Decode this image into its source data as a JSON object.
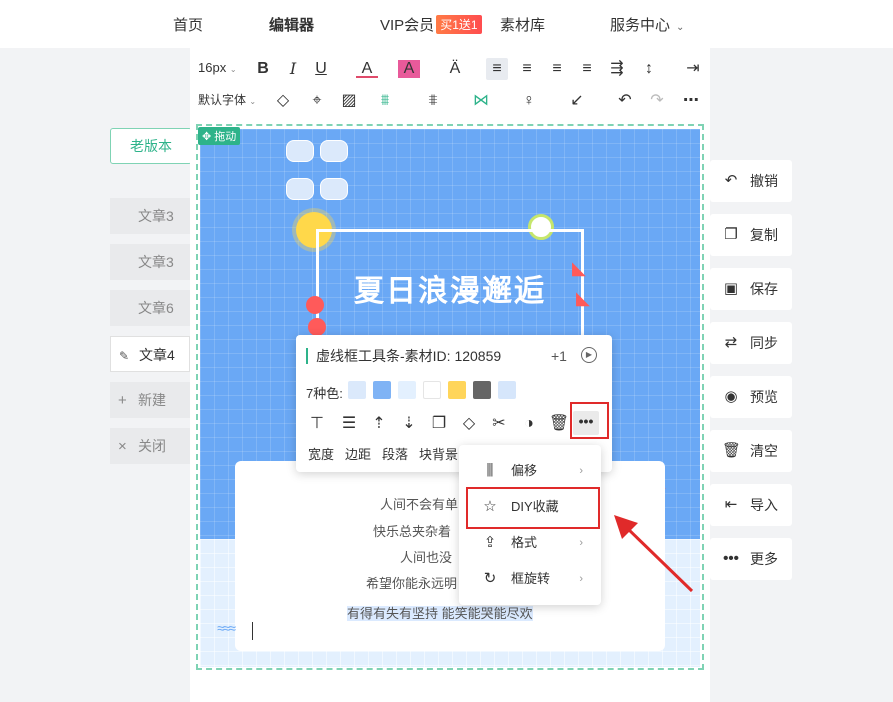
{
  "nav": {
    "items": [
      {
        "label": "首页"
      },
      {
        "label": "编辑器"
      },
      {
        "label": "VIP会员"
      },
      {
        "label": "素材库"
      },
      {
        "label": "服务中心"
      }
    ],
    "vip_badge": "买1送1"
  },
  "toolbar": {
    "font_size": "16px",
    "font_family": "默认字体"
  },
  "left": {
    "old_version": "老版本",
    "docs": [
      {
        "label": "文章3"
      },
      {
        "label": "文章3"
      },
      {
        "label": "文章6"
      },
      {
        "label": "文章4"
      }
    ],
    "new_label": "新建",
    "close_label": "关闭"
  },
  "canvas": {
    "drag_label": "拖动",
    "poster_title": "夏日浪漫邂逅",
    "poem": [
      "人间不会有单",
      "快乐总夹杂着",
      "人间也没",
      "希望你能永远明",
      "有得有失有坚持 能笑能哭能尽欢"
    ],
    "waves": "≈≈≈"
  },
  "popup": {
    "title": "虚线框工具条-素材ID: 120859",
    "plus": "+1",
    "colors_label": "7种色:",
    "colors": [
      "#dbe9fb",
      "#7fb3f5",
      "#e3f0fe",
      "#ffffff",
      "#ffd55a",
      "#666666",
      "#d6e6fb"
    ],
    "tabs": [
      "宽度",
      "边距",
      "段落",
      "块背景"
    ],
    "more_label": "•••"
  },
  "menu": {
    "items": [
      {
        "label": "偏移",
        "arrow": "›"
      },
      {
        "label": "DIY收藏",
        "arrow": ""
      },
      {
        "label": "格式",
        "arrow": "›"
      },
      {
        "label": "框旋转",
        "arrow": "›"
      }
    ]
  },
  "actions": [
    {
      "label": "撤销",
      "icon": "undo-icon"
    },
    {
      "label": "复制",
      "icon": "copy-icon"
    },
    {
      "label": "保存",
      "icon": "save-icon"
    },
    {
      "label": "同步",
      "icon": "sync-icon"
    },
    {
      "label": "预览",
      "icon": "eye-icon"
    },
    {
      "label": "清空",
      "icon": "trash-icon"
    },
    {
      "label": "导入",
      "icon": "import-icon"
    },
    {
      "label": "更多",
      "icon": "more-icon"
    }
  ],
  "colors": {
    "accent": "#2eb38a",
    "highlight_red": "#e02a2a",
    "poster_blue": "#6aa8f5"
  }
}
